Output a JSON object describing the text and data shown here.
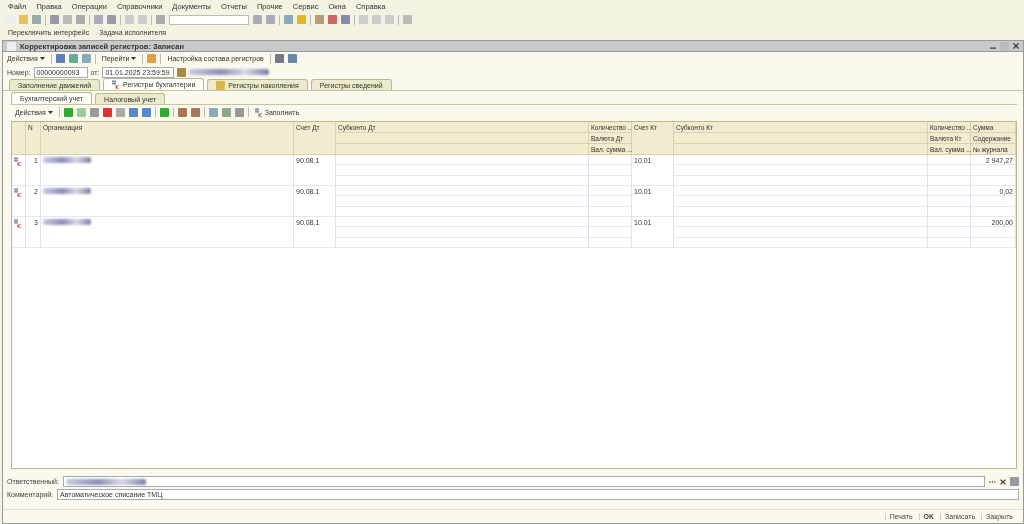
{
  "menu": [
    "Файл",
    "Правка",
    "Операции",
    "Справочники",
    "Документы",
    "Отчеты",
    "Прочие",
    "Сервис",
    "Окна",
    "Справка"
  ],
  "panel": [
    "Переключить интерфейс",
    "Задача исполнителя"
  ],
  "window": {
    "title": "Корректировка записей регистров: Записан"
  },
  "actions": {
    "menu": "Действия",
    "goto": "Перейти",
    "settings": "Настройка состава регистров"
  },
  "header": {
    "number_label": "Номер:",
    "number": "00000000093",
    "date_label": "от:",
    "date": "01.01.2025 23:59:59"
  },
  "tabs": [
    {
      "label": "Заполнение движений",
      "selected": false
    },
    {
      "label": "Регистры бухгалтерии",
      "selected": true
    },
    {
      "label": "Регистры накопления",
      "selected": false
    },
    {
      "label": "Регистры сведений",
      "selected": false
    }
  ],
  "subtabs": [
    {
      "label": "Бухгалтерский учет",
      "selected": true
    },
    {
      "label": "Налоговый учет",
      "selected": false
    }
  ],
  "table_toolbar": {
    "menu": "Действия",
    "fill": "Заполнить"
  },
  "columns": {
    "n": "N",
    "org": "Организация",
    "acc_dt": "Счет Дт",
    "sub_dt": "Субконто Дт",
    "qty_dt": [
      "Количество ...",
      "Валюта Дт",
      "Вал. сумма ..."
    ],
    "acc_kt": "Счет Кт",
    "sub_kt": "Субконто Кт",
    "qty_kt": [
      "Количество ...",
      "Валюта Кт",
      "Вал. сумма ..."
    ],
    "sum": [
      "Сумма",
      "Содержание",
      "№ журнала"
    ]
  },
  "rows": [
    {
      "n": "1",
      "acc_dt": "90.08.1",
      "acc_kt": "10.01",
      "sum": "2 947,27"
    },
    {
      "n": "2",
      "acc_dt": "90.08.1",
      "acc_kt": "10.01",
      "sum": "0,02"
    },
    {
      "n": "3",
      "acc_dt": "90.08.1",
      "acc_kt": "10.01",
      "sum": "200,00"
    }
  ],
  "footer": {
    "responsible_label": "Ответственный:",
    "comment_label": "Комментарий:",
    "comment": "Автоматическое списание ТМЦ"
  },
  "buttons": [
    {
      "label": "Печать",
      "default": false
    },
    {
      "label": "OK",
      "default": true
    },
    {
      "label": "Записать",
      "default": false
    },
    {
      "label": "Закрыть",
      "default": false
    }
  ]
}
